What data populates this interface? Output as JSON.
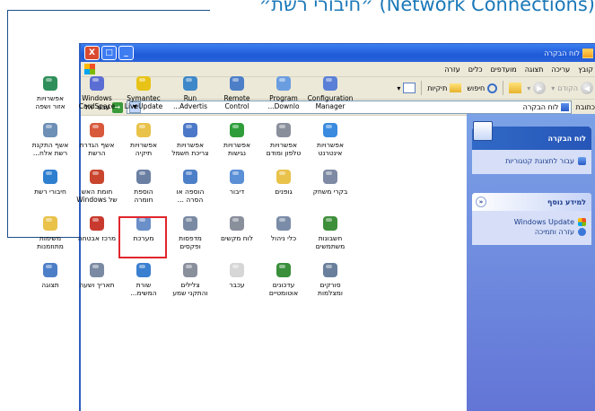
{
  "caption": "״חיבורי רשת״ (Network Connections)",
  "window": {
    "title": "לוח הבקרה",
    "controls": {
      "minimize": "_",
      "maximize": "□",
      "close": "X"
    }
  },
  "menubar": [
    "קובץ",
    "עריכה",
    "תצוגה",
    "מועדפים",
    "כלים",
    "עזרה"
  ],
  "toolbar": {
    "back": "הקודם",
    "search": "חיפוש",
    "folders": "תיקיות",
    "dropdown_arrow": "▾"
  },
  "addressbar": {
    "label": "כתובת",
    "value": "לוח הבקרה",
    "go": "עבור אל"
  },
  "sidepane": {
    "panel1": {
      "title": "לוח הבקרה",
      "link": "עבור לתצוגת קטגוריות"
    },
    "panel2": {
      "title": "למידע נוסף",
      "links": [
        "Windows Update",
        "עזרה ותמיכה"
      ]
    }
  },
  "items": [
    {
      "label": "Configuration\nManager",
      "icon": "configuration-manager-icon",
      "color": "#5a7fd6"
    },
    {
      "label": "Program\nDownlo...",
      "icon": "program-download-icon",
      "color": "#6a9de0"
    },
    {
      "label": "Remote\nControl",
      "icon": "remote-control-icon",
      "color": "#4d7fc8"
    },
    {
      "label": "Run\nAdvertis...",
      "icon": "run-advertised-icon",
      "color": "#3e88c9"
    },
    {
      "label": "Symantec\nLiveUpdate",
      "icon": "symantec-liveupdate-icon",
      "color": "#e8c317"
    },
    {
      "label": "Windows\nCardSpace",
      "icon": "cardspace-icon",
      "color": "#5b6ed3"
    },
    {
      "label": "אפשרויות\nאזור ושפה",
      "icon": "regional-language-icon",
      "color": "#2f8f5a"
    },
    {
      "label": "אפשרויות\nאינטרנט",
      "icon": "internet-options-icon",
      "color": "#3a8ae0"
    },
    {
      "label": "אפשרויות\nטלפון ומודם",
      "icon": "phone-modem-icon",
      "color": "#8a8f9c"
    },
    {
      "label": "אפשרויות\nנגישות",
      "icon": "accessibility-icon",
      "color": "#2f9e3a"
    },
    {
      "label": "אפשרויות\nצריכת חשמל",
      "icon": "power-options-icon",
      "color": "#4c78c9"
    },
    {
      "label": "אפשרויות\nתיקיה",
      "icon": "folder-options-icon",
      "color": "#e9c24a"
    },
    {
      "label": "אשף הגדרת\nהרשת",
      "icon": "network-setup-icon",
      "color": "#d8593b"
    },
    {
      "label": "אשף התקנת\nרשת אלח...",
      "icon": "wireless-setup-icon",
      "color": "#6e8fb6"
    },
    {
      "label": "בקרי משחק",
      "icon": "game-controllers-icon",
      "color": "#7e8aa3"
    },
    {
      "label": "גופנים",
      "icon": "fonts-icon",
      "color": "#e9c24a"
    },
    {
      "label": "דיבור",
      "icon": "speech-icon",
      "color": "#5b8fd6"
    },
    {
      "label": "הוספה או\nהסרה ...",
      "icon": "add-remove-icon",
      "color": "#4d7fc8"
    },
    {
      "label": "הוספת\nחומרה",
      "icon": "add-hardware-icon",
      "color": "#6b7fa3"
    },
    {
      "label": "חומת האש\nשל Windows",
      "icon": "firewall-icon",
      "color": "#c9452e"
    },
    {
      "label": "חיבורי רשת",
      "icon": "network-connections-icon",
      "color": "#2f7fd0"
    },
    {
      "label": "חשבונות\nמשתמשים",
      "icon": "user-accounts-icon",
      "color": "#3e8f3a"
    },
    {
      "label": "כלי ניהול",
      "icon": "admin-tools-icon",
      "color": "#7a8ca8"
    },
    {
      "label": "לוח מקשים",
      "icon": "keyboard-icon",
      "color": "#8a8f9c"
    },
    {
      "label": "מדפסות\nופקסים",
      "icon": "printers-faxes-icon",
      "color": "#7a8aa3"
    },
    {
      "label": "מערכת",
      "icon": "system-icon",
      "color": "#6a8fc9"
    },
    {
      "label": "מרכז אבטחה",
      "icon": "security-center-icon",
      "color": "#c93a2e"
    },
    {
      "label": "משימות\nמתוזמנות",
      "icon": "scheduled-tasks-icon",
      "color": "#e9c24a"
    },
    {
      "label": "סורקים\nומצלמות",
      "icon": "scanners-cameras-icon",
      "color": "#6a7f9c"
    },
    {
      "label": "עדכונים\nאוטומטיים",
      "icon": "automatic-updates-icon",
      "color": "#3a8f3a"
    },
    {
      "label": "עכבר",
      "icon": "mouse-icon",
      "color": "#d6d6d6"
    },
    {
      "label": "צלילים\nוהתקני שמע",
      "icon": "sounds-audio-icon",
      "color": "#8a8f9c"
    },
    {
      "label": "שורת\nהמשימ...",
      "icon": "taskbar-icon",
      "color": "#3a7fd0"
    },
    {
      "label": "תאריך ושעה",
      "icon": "date-time-icon",
      "color": "#7a8aa3"
    },
    {
      "label": "תצוגה",
      "icon": "display-icon",
      "color": "#4d7fc8"
    }
  ]
}
